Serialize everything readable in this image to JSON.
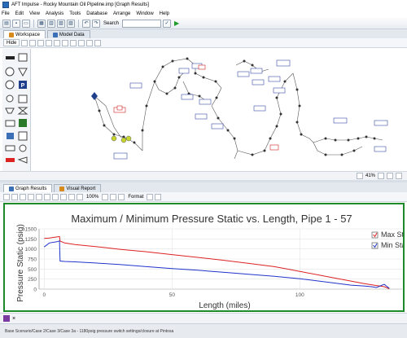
{
  "window": {
    "title": "AFT Impulse - Rocky Mountain Oil Pipeline.imp [Graph Results]"
  },
  "menu": [
    "File",
    "Edit",
    "View",
    "Analysis",
    "Tools",
    "Database",
    "Arrange",
    "Window",
    "Help"
  ],
  "toolbar": {
    "search_label": "Search"
  },
  "workspace_tabs": [
    "Workspace",
    "Model Data"
  ],
  "workspace_toolbar": {
    "hide_label": "Hide"
  },
  "workspace_status": {
    "zoom": "41%"
  },
  "graph_tabs": [
    "Graph Results",
    "Visual Report"
  ],
  "graph_toolbar": {
    "zoom": "100%",
    "format_label": "Format"
  },
  "chart_data": {
    "type": "line",
    "title": "Maximum / Minimum Pressure Static vs. Length, Pipe 1 - 57",
    "xlabel": "Length (miles)",
    "ylabel": "Pressure Static (psig)",
    "xlim": [
      -2,
      140
    ],
    "ylim": [
      0,
      1500
    ],
    "x_ticks": [
      0,
      50,
      100
    ],
    "y_ticks": [
      0,
      250,
      500,
      750,
      1000,
      1250,
      1500
    ],
    "grid": true,
    "legend": "top-right",
    "series": [
      {
        "name": "Max Static",
        "color": "#dd2222",
        "x": [
          0,
          2,
          5,
          6,
          6.2,
          8,
          12,
          20,
          30,
          40,
          50,
          60,
          70,
          80,
          90,
          95,
          100,
          110,
          120,
          125,
          128,
          130,
          133,
          135
        ],
        "y": [
          1260,
          1270,
          1300,
          1310,
          1195,
          1150,
          1110,
          1060,
          990,
          930,
          860,
          790,
          720,
          640,
          560,
          500,
          440,
          320,
          200,
          140,
          110,
          90,
          60,
          10
        ]
      },
      {
        "name": "Min Static",
        "color": "#2233cc",
        "x": [
          0,
          2,
          5,
          6,
          6.2,
          8,
          12,
          20,
          30,
          40,
          50,
          60,
          70,
          80,
          90,
          100,
          110,
          115,
          120,
          125,
          128,
          130,
          133,
          135
        ],
        "y": [
          1050,
          1150,
          1180,
          1200,
          700,
          690,
          680,
          650,
          610,
          560,
          510,
          470,
          420,
          370,
          320,
          260,
          180,
          140,
          100,
          80,
          60,
          40,
          120,
          20
        ]
      }
    ]
  },
  "bottom_tab": {
    "close": "×"
  },
  "status": {
    "text": "Base Scenario/Case 2/Case 3/Case 3a - 1180psig pressure switch settings/closure at Pintosa"
  },
  "colors": {
    "accent_green": "#1f8a2a",
    "max_series": "#dd2222",
    "min_series": "#2233cc"
  }
}
